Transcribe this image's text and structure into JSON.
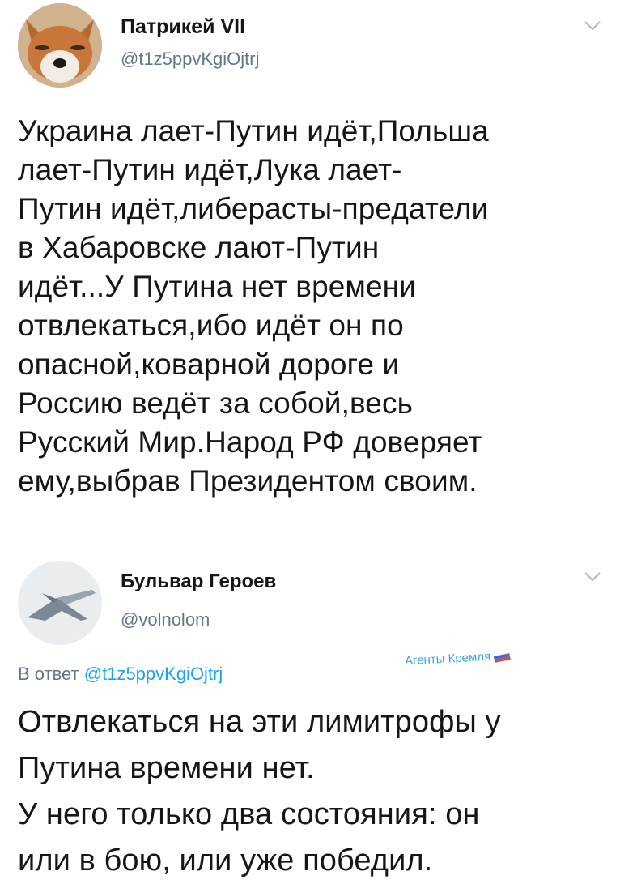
{
  "tweet": {
    "author": {
      "display_name": "Патрикей VII",
      "handle": "@t1z5ppvKgiOjtrj",
      "avatar_icon": "fox-avatar"
    },
    "lines": [
      "Украина лает-Путин идёт,Польша",
      "лает-Путин идёт,Лука лает-",
      "Путин идёт,либерасты-предатели",
      "в Хабаровске лают-Путин",
      "идёт...У Путина нет времени",
      "отвлекаться,ибо идёт он по",
      "опасной,коварной дороге и",
      "Россию ведёт за собой,весь",
      "Русский Мир.Народ РФ доверяет",
      "ему,выбрав Президентом своим."
    ]
  },
  "reply": {
    "author": {
      "display_name": "Бульвар Героев",
      "handle": "@volnolom",
      "avatar_icon": "fighter-jet-avatar"
    },
    "reply_prefix": "В ответ",
    "reply_mention": "@t1z5ppvKgiOjtrj",
    "lines": [
      "Отвлекаться на эти лимитрофы у",
      "Путина времени нет.",
      "У него только два состояния: он",
      "или в бою, или уже победил."
    ]
  },
  "watermark": {
    "text": "Агенты Кремля",
    "icon": "russian-flag-icon"
  },
  "colors": {
    "text": "#14171a",
    "secondary": "#657786",
    "link": "#1da1f2"
  }
}
